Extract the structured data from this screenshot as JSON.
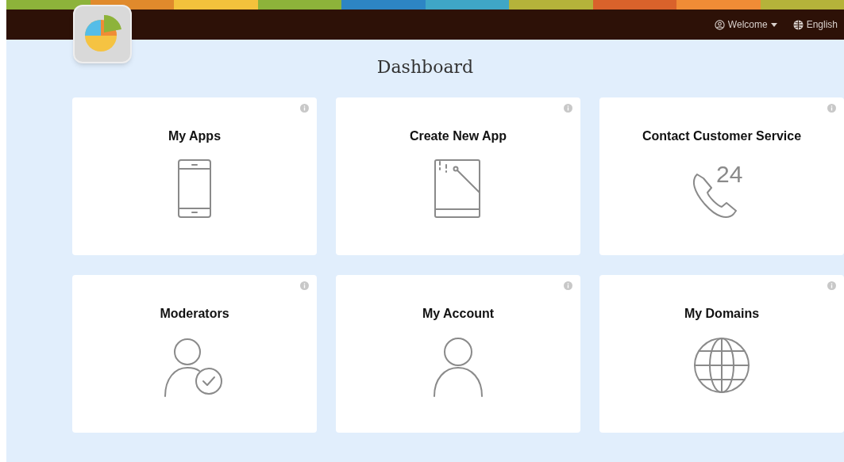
{
  "header": {
    "user_menu": "Welcome",
    "language": "English"
  },
  "page_title": "Dashboard",
  "cards": [
    {
      "title": "My Apps",
      "kind": "phone"
    },
    {
      "title": "Create New App",
      "kind": "book"
    },
    {
      "title": "Contact Customer Service",
      "kind": "support",
      "icon_label": "24"
    },
    {
      "title": "Moderators",
      "kind": "moderator"
    },
    {
      "title": "My Account",
      "kind": "person"
    },
    {
      "title": "My Domains",
      "kind": "globe"
    }
  ]
}
